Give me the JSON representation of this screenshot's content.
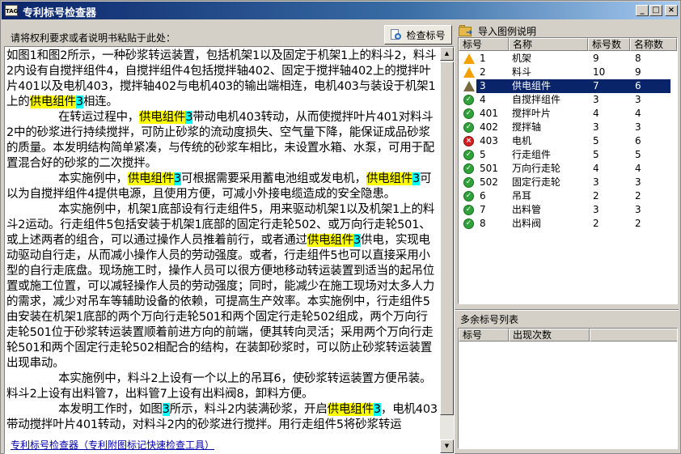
{
  "window": {
    "app_icon_text": "TAG",
    "title": "专利标号检查器",
    "min_glyph": "_",
    "max_glyph": "□",
    "close_glyph": "×"
  },
  "left": {
    "prompt": "请将权利要求或者说明书粘贴于此处：",
    "check_button": "检查标号",
    "footer_link": "专利标号检查器（专利附图标记快速检查工具）",
    "scroll_up": "▲",
    "scroll_down": "▼",
    "text_paragraphs": [
      {
        "indent": false,
        "segments": [
          {
            "t": "如图1和图2所示，一种砂浆转运装置，包括机架1以及固定于机架1上的料斗2，料斗2内设有自搅拌组件4，自搅拌组件4包括搅拌轴402、固定于搅拌轴402上的搅拌叶片401以及电机403，搅拌轴402与电机403的输出端相连，电机403与装设于机架1上的"
          },
          {
            "t": "供电组件",
            "h": "name"
          },
          {
            "t": "3",
            "h": "num"
          },
          {
            "t": "相连。"
          }
        ]
      },
      {
        "indent": true,
        "segments": [
          {
            "t": "在转运过程中，"
          },
          {
            "t": "供电组件",
            "h": "name"
          },
          {
            "t": "3",
            "h": "num"
          },
          {
            "t": "带动电机403转动，从而使搅拌叶片401对料斗2中的砂浆进行持续搅拌，可防止砂浆的流动度损失、空气量下降，能保证成品砂浆的质量。本发明结构简单紧凑，与传统的砂浆车相比，未设置水箱、水泵，可用于配置混合好的砂浆的二次搅拌。"
          }
        ]
      },
      {
        "indent": true,
        "segments": [
          {
            "t": "本实施例中，"
          },
          {
            "t": "供电组件",
            "h": "name"
          },
          {
            "t": "3",
            "h": "num"
          },
          {
            "t": "可根据需要采用蓄电池组或发电机，"
          },
          {
            "t": "供电组件",
            "h": "name"
          },
          {
            "t": "3",
            "h": "num"
          },
          {
            "t": "可以为自搅拌组件4提供电源，且使用方便，可减小外接电缆造成的安全隐患。"
          }
        ]
      },
      {
        "indent": true,
        "segments": [
          {
            "t": "本实施例中，机架1底部设有行走组件5，用来驱动机架1以及机架1上的料斗2运动。行走组件5包括安装于机架1底部的固定行走轮502、或万向行走轮501、或上述两者的组合，可以通过操作人员推着前行，或者通过"
          },
          {
            "t": "供电组件",
            "h": "name"
          },
          {
            "t": "3",
            "h": "num"
          },
          {
            "t": "供电，实现电动驱动自行走，从而减小操作人员的劳动强度。或者，行走组件5也可以直接采用小型的自行走底盘。现场施工时，操作人员可以很方便地移动转运装置到适当的起吊位置或施工位置，可以减轻操作人员的劳动强度；同时，能减少在施工现场对太多人力的需求，减少对吊车等辅助设备的依赖，可提高生产效率。本实施例中，行走组件5由安装在机架1底部的两个万向行走轮501和两个固定行走轮502组成，两个万向行走轮501位于砂浆转运装置顺着前进方向的前端，便其转向灵活；采用两个万向行走轮501和两个固定行走轮502相配合的结构，在装卸砂浆时，可以防止砂浆转运装置出现串动。"
          }
        ]
      },
      {
        "indent": true,
        "segments": [
          {
            "t": "本实施例中，料斗2上设有一个以上的吊耳6，使砂浆转运装置方便吊装。料斗2上设有出料管7，出料管7上设有出料阀8，卸料方便。"
          }
        ]
      },
      {
        "indent": true,
        "segments": [
          {
            "t": "本发明工作时，如图"
          },
          {
            "t": "3",
            "h": "num"
          },
          {
            "t": "所示，料斗2内装满砂浆，开启"
          },
          {
            "t": "供电组件",
            "h": "name"
          },
          {
            "t": "3",
            "h": "num"
          },
          {
            "t": "，电机403带动搅拌叶片401转动，对料斗2内的砂浆进行搅拌。用行走组件5将砂浆转运"
          }
        ]
      }
    ]
  },
  "right": {
    "import_label": "导入图例说明",
    "legend_headers": [
      "标号",
      "名称",
      "标号数",
      "名称数"
    ],
    "legend_rows": [
      {
        "status": "warn",
        "num": "1",
        "name": "机架",
        "num_count": "9",
        "name_count": "8",
        "selected": false
      },
      {
        "status": "warn",
        "num": "2",
        "name": "料斗",
        "num_count": "10",
        "name_count": "9",
        "selected": false
      },
      {
        "status": "warn-dark",
        "num": "3",
        "name": "供电组件",
        "num_count": "7",
        "name_count": "6",
        "selected": true
      },
      {
        "status": "ok",
        "num": "4",
        "name": "自搅拌组件",
        "num_count": "3",
        "name_count": "3",
        "selected": false
      },
      {
        "status": "ok",
        "num": "401",
        "name": "搅拌叶片",
        "num_count": "4",
        "name_count": "4",
        "selected": false
      },
      {
        "status": "ok",
        "num": "402",
        "name": "搅拌轴",
        "num_count": "3",
        "name_count": "3",
        "selected": false
      },
      {
        "status": "err",
        "num": "403",
        "name": "电机",
        "num_count": "5",
        "name_count": "6",
        "selected": false
      },
      {
        "status": "ok",
        "num": "5",
        "name": "行走组件",
        "num_count": "5",
        "name_count": "5",
        "selected": false
      },
      {
        "status": "ok",
        "num": "501",
        "name": "万向行走轮",
        "num_count": "4",
        "name_count": "4",
        "selected": false
      },
      {
        "status": "ok",
        "num": "502",
        "name": "固定行走轮",
        "num_count": "3",
        "name_count": "3",
        "selected": false
      },
      {
        "status": "ok",
        "num": "6",
        "name": "吊耳",
        "num_count": "2",
        "name_count": "2",
        "selected": false
      },
      {
        "status": "ok",
        "num": "7",
        "name": "出料管",
        "num_count": "3",
        "name_count": "3",
        "selected": false
      },
      {
        "status": "ok",
        "num": "8",
        "name": "出料阀",
        "num_count": "2",
        "name_count": "2",
        "selected": false
      }
    ],
    "extra_section_label": "多余标号列表",
    "extra_headers": [
      "标号",
      "出现次数"
    ],
    "extra_rows": []
  }
}
